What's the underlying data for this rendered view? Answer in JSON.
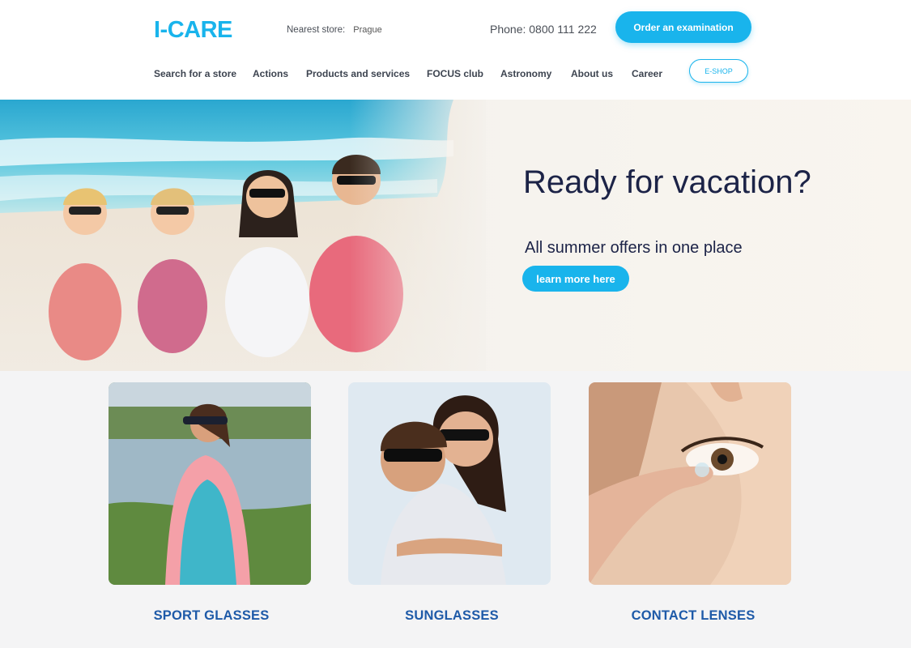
{
  "header": {
    "logo": "I-CARE",
    "nearest_store_label": "Nearest store:",
    "nearest_store_city": "Prague",
    "phone": "Phone: 0800 111 222",
    "order_button": "Order an examination",
    "eshop_button": "E-SHOP",
    "nav": [
      {
        "label": "Search for a store"
      },
      {
        "label": "Actions"
      },
      {
        "label": "Products and services"
      },
      {
        "label": "FOCUS club"
      },
      {
        "label": "Astronomy"
      },
      {
        "label": "About us"
      },
      {
        "label": "Career"
      }
    ]
  },
  "hero": {
    "title": "Ready for vacation?",
    "subtitle": "All summer offers in one place",
    "button": "learn more here"
  },
  "categories": [
    {
      "label": "SPORT GLASSES"
    },
    {
      "label": "SUNGLASSES"
    },
    {
      "label": "CONTACT LENSES"
    }
  ],
  "colors": {
    "accent": "#19b4ec",
    "category_text": "#1e5aa8",
    "hero_text": "#1c2347"
  }
}
